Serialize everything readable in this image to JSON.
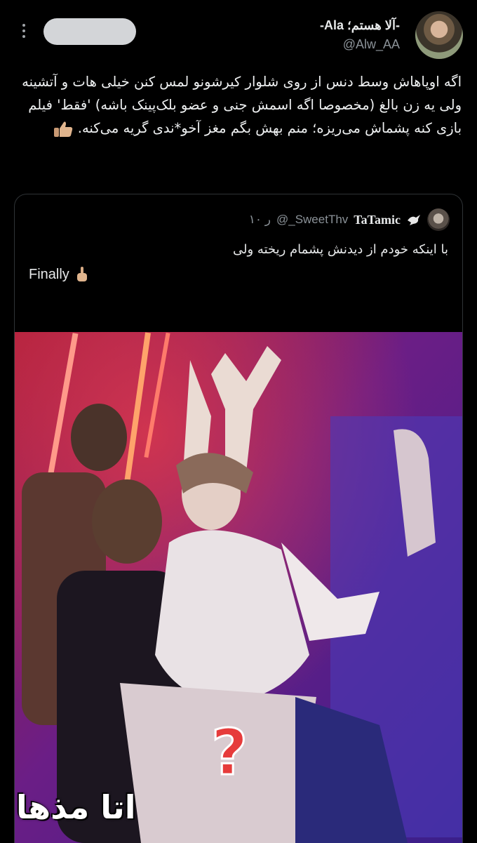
{
  "author": {
    "display_name": "-آلا هستم؛ Ala-",
    "handle": "@Alw_AA"
  },
  "tweet": {
    "text": "اگه اوپاهاش وسط دنس از روی شلوار کیرشونو لمس کنن خیلی هات و آتشینه ولی یه زن بالغ (مخصوصا اگه اسمش جنی و عضو بلک‌پینک باشه) 'فقط' فیلم بازی کنه پشماش می‌ریزه؛ منم بهش بگم مغز آخو*ندی گریه می‌کنه.",
    "emoji": "thumbs-up-emoji"
  },
  "quote": {
    "name": "TaTamic",
    "handle": "@_SweetThv",
    "time": "۱۰ ر",
    "text_line1": "با اینکه خودم از دیدنش پشمام ریخته ولی",
    "text_line2": "Finally",
    "emoji2": "middle-finger-emoji",
    "image_overlay_text": "اتا مذها",
    "image_description_icon": "question-mark-icon"
  },
  "colors": {
    "background": "#000000",
    "text": "#e7e9ea",
    "muted": "#8b9298",
    "border": "#2f3336"
  }
}
